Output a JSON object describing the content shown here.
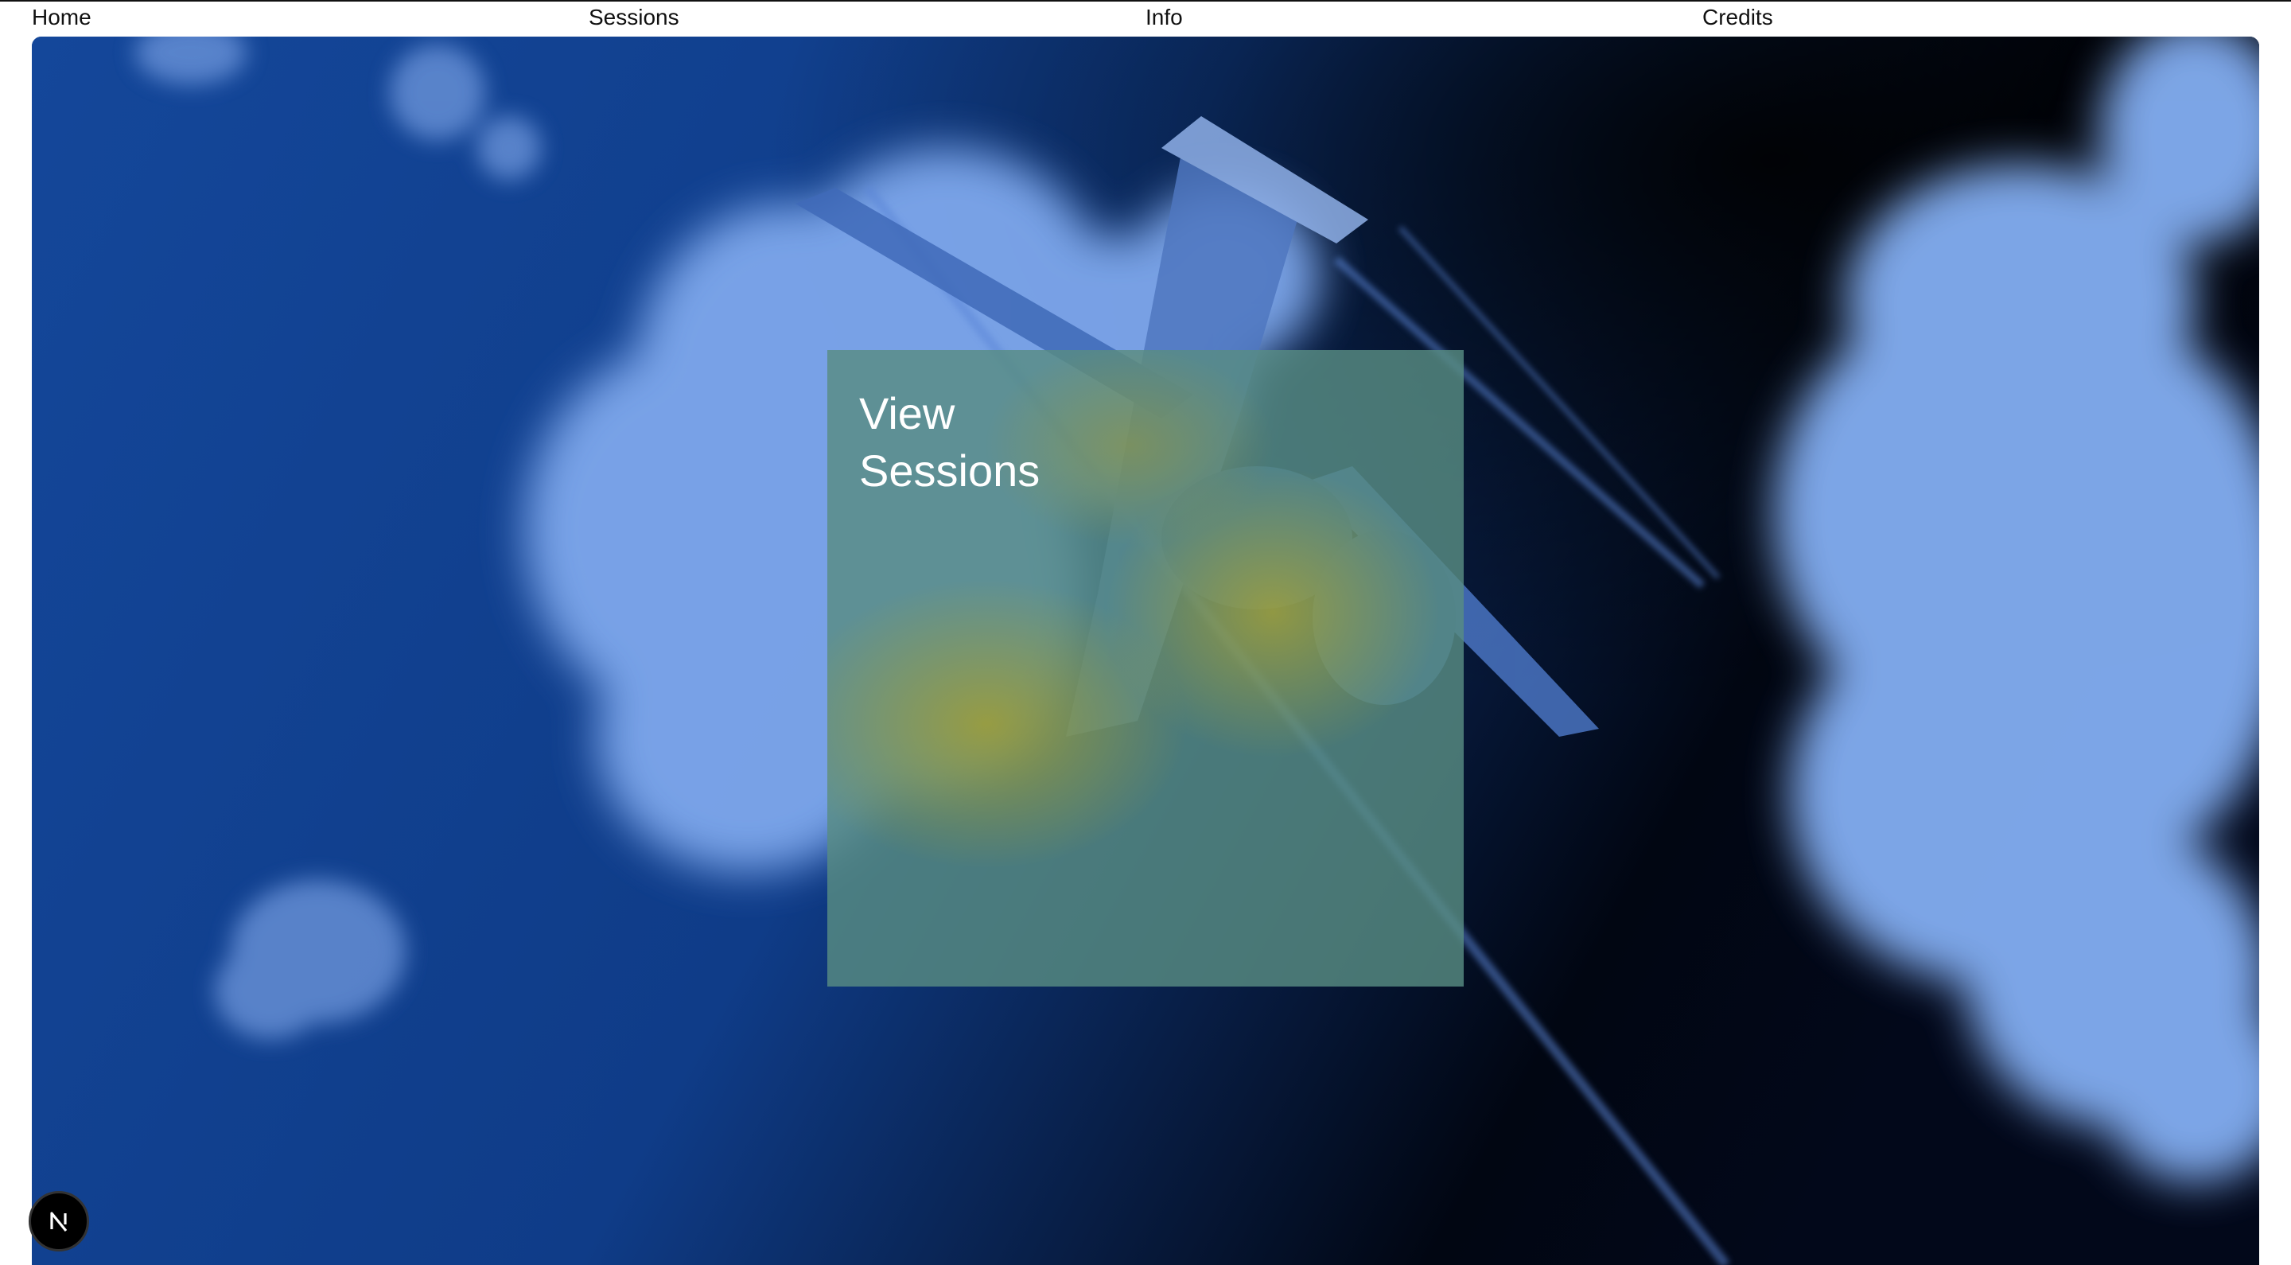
{
  "nav": {
    "items": [
      {
        "label": "Home"
      },
      {
        "label": "Sessions"
      },
      {
        "label": "Info"
      },
      {
        "label": "Credits"
      }
    ]
  },
  "hero": {
    "background_color": "#103f8f",
    "card": {
      "title_line1": "View",
      "title_line2": "Sessions",
      "tint_color": "#588c82"
    }
  },
  "devtools": {
    "icon": "nextjs-n-icon",
    "letter": "N"
  }
}
